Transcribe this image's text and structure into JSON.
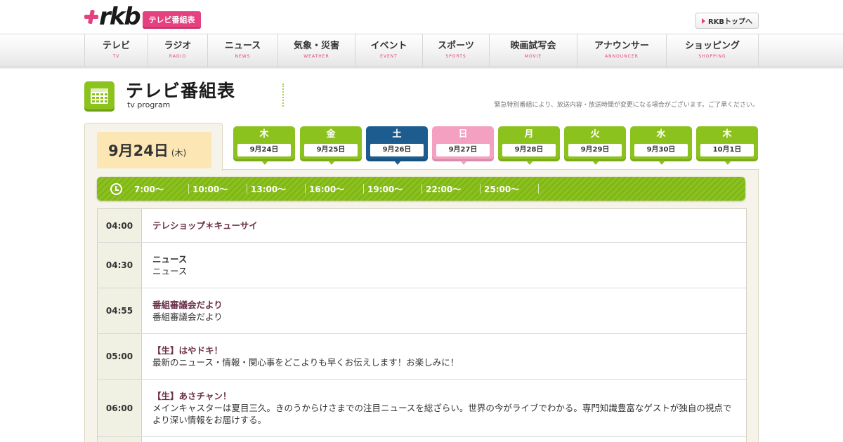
{
  "header": {
    "logo_text": "rkb",
    "badge": "テレビ番組表",
    "top_link": "RKBトップへ",
    "colors": {
      "brand_pink": "#e5407f",
      "green": "#8cc21e",
      "active_blue": "#1c5c8e",
      "sunday_pink": "#f4a0c1"
    }
  },
  "nav": [
    {
      "jp": "テレビ",
      "en": "TV"
    },
    {
      "jp": "ラジオ",
      "en": "RADIO"
    },
    {
      "jp": "ニュース",
      "en": "NEWS"
    },
    {
      "jp": "気象・災害",
      "en": "WEATHER"
    },
    {
      "jp": "イベント",
      "en": "EVENT"
    },
    {
      "jp": "スポーツ",
      "en": "SPORTS"
    },
    {
      "jp": "映画試写会",
      "en": "MOVIE"
    },
    {
      "jp": "アナウンサー",
      "en": "ANNOUNCER"
    },
    {
      "jp": "ショッピング",
      "en": "SHOPPING"
    }
  ],
  "title": {
    "jp": "テレビ番組表",
    "en": "tv program",
    "notice": "緊急特別番組により、放送内容・放送時間が変更になる場合がございます。ご了承ください。"
  },
  "current_date": {
    "main": "9月24日",
    "dow": "(木)"
  },
  "days": [
    {
      "dow": "木",
      "date": "9月24日",
      "state": "normal"
    },
    {
      "dow": "金",
      "date": "9月25日",
      "state": "normal"
    },
    {
      "dow": "土",
      "date": "9月26日",
      "state": "active"
    },
    {
      "dow": "日",
      "date": "9月27日",
      "state": "sun"
    },
    {
      "dow": "月",
      "date": "9月28日",
      "state": "normal"
    },
    {
      "dow": "火",
      "date": "9月29日",
      "state": "normal"
    },
    {
      "dow": "水",
      "date": "9月30日",
      "state": "normal"
    },
    {
      "dow": "木",
      "date": "10月1日",
      "state": "normal"
    }
  ],
  "time_slots": [
    "7:00～",
    "10:00～",
    "13:00～",
    "16:00～",
    "19:00～",
    "22:00～",
    "25:00～"
  ],
  "programs": [
    {
      "time": "04:00",
      "title": "テレショップ＊キューサイ",
      "desc": ""
    },
    {
      "time": "04:30",
      "title": "ニュース",
      "desc": "ニュース"
    },
    {
      "time": "04:55",
      "title": "番組審議会だより",
      "desc": "番組審議会だより"
    },
    {
      "time": "05:00",
      "title": "【生】はやドキ！",
      "desc": "最新のニュース・情報・関心事をどこよりも早くお伝えします！お楽しみに！"
    },
    {
      "time": "06:00",
      "title": "【生】あさチャン！",
      "desc": "メインキャスターは夏目三久。きのうからけさまでの注目ニュースを総ざらい。世界の今がライブでわかる。専門知識豊富なゲストが独自の視点でより深い情報をお届けする。"
    }
  ]
}
